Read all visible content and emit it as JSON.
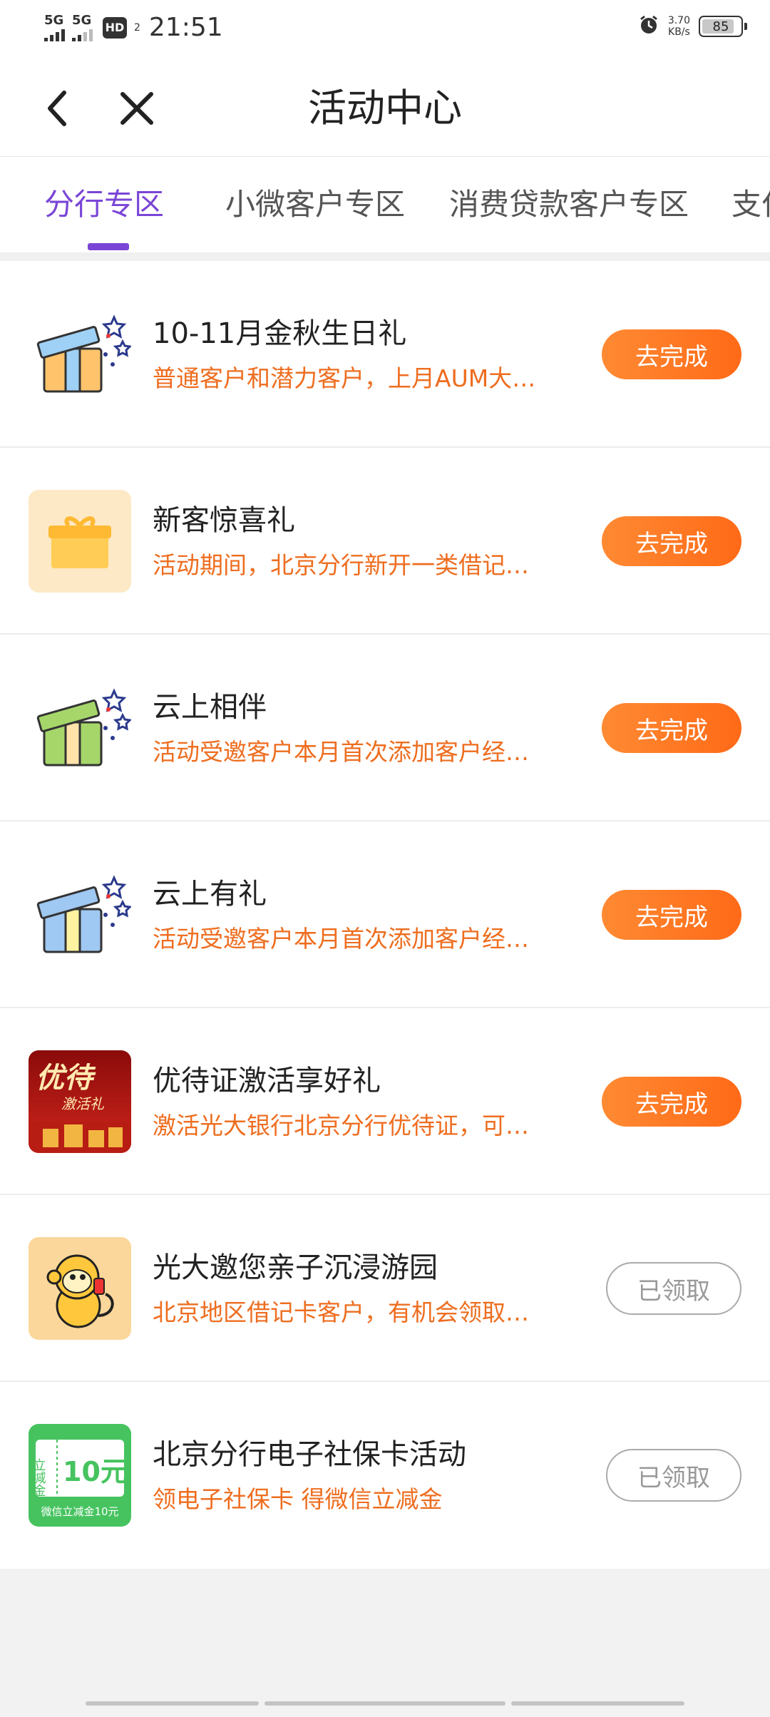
{
  "status_bar": {
    "signal_1": "5G",
    "signal_2": "5G",
    "hd": "HD",
    "hd_sub": "2",
    "time": "21:51",
    "speed_value": "3.70",
    "speed_unit": "KB/s",
    "battery": "85",
    "battery_level": 0.85
  },
  "header": {
    "title": "活动中心",
    "back_icon": "chevron-left-icon",
    "close_icon": "close-icon"
  },
  "tabs": [
    {
      "label": "分行专区",
      "active": true
    },
    {
      "label": "小微客户专区",
      "active": false
    },
    {
      "label": "消费贷款客户专区",
      "active": false
    },
    {
      "label": "支付",
      "active": false
    }
  ],
  "activities": [
    {
      "title": "10-11月金秋生日礼",
      "desc": "普通客户和潜力客户，上月AUM大…",
      "button": "去完成",
      "status": "go",
      "icon": "gift-box-blue-orange-icon"
    },
    {
      "title": "新客惊喜礼",
      "desc": "活动期间，北京分行新开一类借记…",
      "button": "去完成",
      "status": "go",
      "icon": "gift-box-yellow-icon"
    },
    {
      "title": "云上相伴",
      "desc": "活动受邀客户本月首次添加客户经…",
      "button": "去完成",
      "status": "go",
      "icon": "gift-box-green-icon"
    },
    {
      "title": "云上有礼",
      "desc": "活动受邀客户本月首次添加客户经…",
      "button": "去完成",
      "status": "go",
      "icon": "gift-box-blue-icon"
    },
    {
      "title": "优待证激活享好礼",
      "desc": "激活光大银行北京分行优待证，可…",
      "button": "去完成",
      "status": "go",
      "icon": "red-banner-icon",
      "thumb_text_1": "优待",
      "thumb_text_2": "激活礼"
    },
    {
      "title": "光大邀您亲子沉浸游园",
      "desc": "北京地区借记卡客户，有机会领取…",
      "button": "已领取",
      "status": "claimed",
      "icon": "monkey-icon"
    },
    {
      "title": "北京分行电子社保卡活动",
      "desc": "领电子社保卡 得微信立减金",
      "button": "已领取",
      "status": "claimed",
      "icon": "green-coupon-icon",
      "thumb_text_1": "立减金",
      "thumb_text_2": "10元",
      "thumb_text_3": "微信立减金10元"
    }
  ],
  "colors": {
    "accent_purple": "#7a45d6",
    "orange_text": "#ee6d1f",
    "button_orange": "#ff6a17"
  }
}
